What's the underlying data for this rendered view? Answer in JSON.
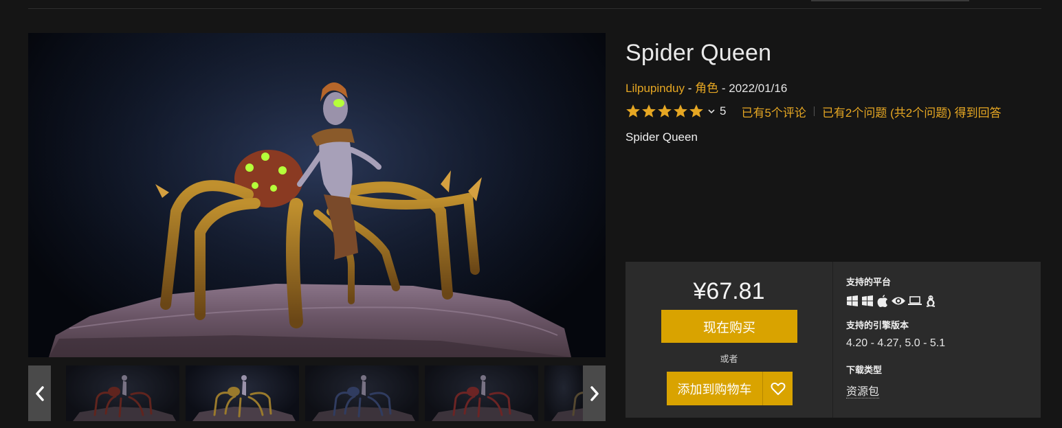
{
  "product": {
    "title": "Spider Queen",
    "author": "Lilpupinduy",
    "dash1": " - ",
    "category": "角色",
    "dash2": " - ",
    "date": "2022/01/16",
    "rating": 5,
    "rating_count": "5",
    "reviews_link": "已有5个评论",
    "questions_link": "已有2个问题 (共2个问题) 得到回答",
    "subtitle": "Spider Queen"
  },
  "purchase": {
    "price": "¥67.81",
    "buy_label": "现在购买",
    "or_label": "或者",
    "add_to_cart_label": "添加到购物车"
  },
  "specs": {
    "platforms_heading": "支持的平台",
    "platform_icons": [
      "windows-icon",
      "windows-icon",
      "apple-icon",
      "eye-icon",
      "laptop-icon",
      "linux-icon"
    ],
    "engine_heading": "支持的引擎版本",
    "engine_versions": "4.20 - 4.27, 5.0 - 5.1",
    "download_heading": "下载类型",
    "download_type": "资源包"
  },
  "gallery": {
    "thumbnail_tints": [
      "#7a2a22",
      "#9a7a2c",
      "#3a4a7a",
      "#8a2a2a",
      "#6a5a3a"
    ],
    "selected_index": 1
  },
  "colors": {
    "accent": "#d9a300",
    "link": "#e6a723",
    "panel": "#2b2b2b",
    "background": "#151515"
  }
}
